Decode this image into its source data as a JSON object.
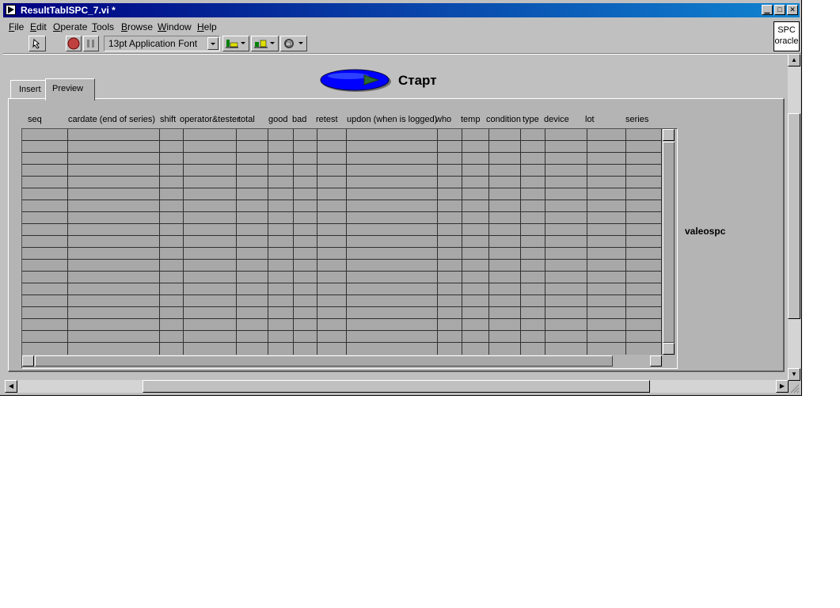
{
  "window": {
    "title": "ResultTablSPC_7.vi *",
    "minimize": "▁",
    "maximize": "□",
    "close": "✕"
  },
  "menus": [
    {
      "accel": "F",
      "rest": "ile"
    },
    {
      "accel": "E",
      "rest": "dit"
    },
    {
      "accel": "O",
      "rest": "perate"
    },
    {
      "accel": "T",
      "rest": "ools"
    },
    {
      "accel": "B",
      "rest": "rowse"
    },
    {
      "accel": "W",
      "rest": "indow"
    },
    {
      "accel": "H",
      "rest": "elp"
    }
  ],
  "toolbar": {
    "font": "13pt Application Font"
  },
  "spc_box": {
    "line1": "SPC",
    "line2": "oracle"
  },
  "start_button": {
    "label": "Старт",
    "color": "#0000ff"
  },
  "tabs": [
    {
      "label": "Insert"
    },
    {
      "label": "Preview",
      "selected": true
    }
  ],
  "table": {
    "columns": [
      "seq",
      "cardate (end of series)",
      "shift",
      "operator&tester",
      "total",
      "good",
      "bad",
      "retest",
      "updon (when is logged)",
      "who",
      "temp",
      "condition",
      "type",
      "device",
      "lot",
      "series"
    ]
  },
  "db_label": "valeospc"
}
